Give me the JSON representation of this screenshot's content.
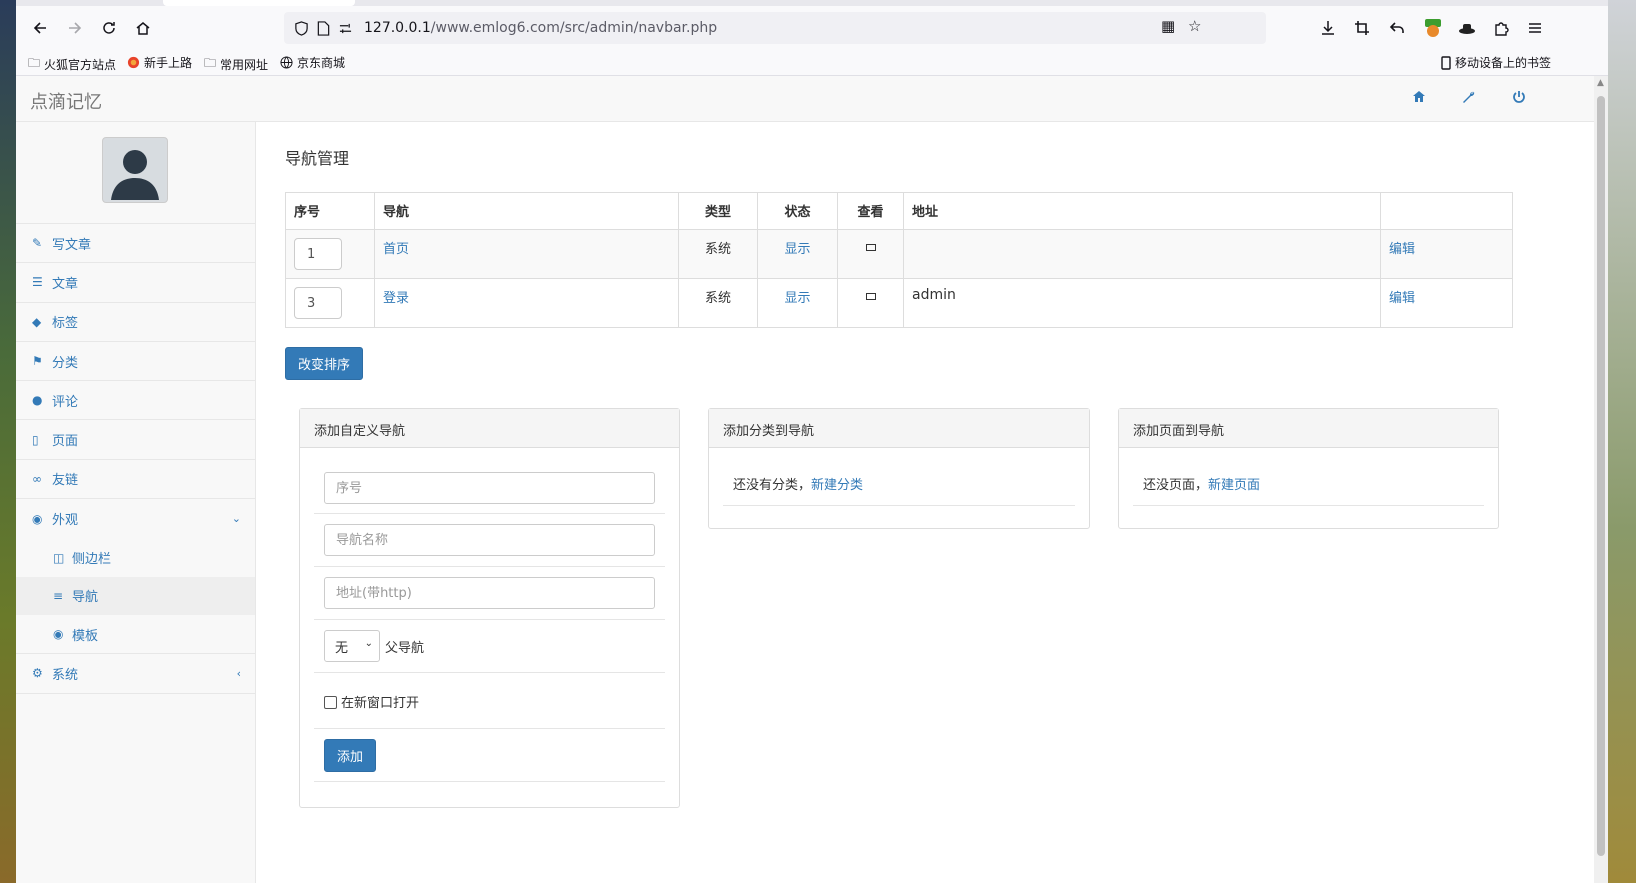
{
  "browser": {
    "url_host": "127.0.0.1",
    "url_path": "/www.emlog6.com/src/admin/navbar.php",
    "bookmarks": [
      "火狐官方站点",
      "新手上路",
      "常用网址",
      "京东商城"
    ],
    "mobile_bookmarks": "移动设备上的书签"
  },
  "header": {
    "brand": "点滴记忆"
  },
  "sidebar": {
    "items": [
      {
        "label": "写文章",
        "icon": "edit-icon"
      },
      {
        "label": "文章",
        "icon": "list-icon"
      },
      {
        "label": "标签",
        "icon": "tags-icon"
      },
      {
        "label": "分类",
        "icon": "flag-icon"
      },
      {
        "label": "评论",
        "icon": "comments-icon"
      },
      {
        "label": "页面",
        "icon": "file-icon"
      },
      {
        "label": "友链",
        "icon": "link-icon"
      },
      {
        "label": "外观",
        "icon": "eye-icon"
      }
    ],
    "sub_items": [
      {
        "label": "侧边栏",
        "icon": "columns-icon"
      },
      {
        "label": "导航",
        "icon": "bars-icon"
      },
      {
        "label": "模板",
        "icon": "eye-icon"
      }
    ],
    "system": {
      "label": "系统",
      "icon": "gear-icon"
    }
  },
  "main": {
    "title": "导航管理",
    "table": {
      "headers": [
        "序号",
        "导航",
        "类型",
        "状态",
        "查看",
        "地址",
        ""
      ],
      "rows": [
        {
          "order": "1",
          "name": "首页",
          "type": "系统",
          "status": "显示",
          "address": "",
          "action": "编辑"
        },
        {
          "order": "3",
          "name": "登录",
          "type": "系统",
          "status": "显示",
          "address": "admin",
          "action": "编辑"
        }
      ]
    },
    "sort_button": "改变排序",
    "custom_panel": {
      "title": "添加自定义导航",
      "order_placeholder": "序号",
      "name_placeholder": "导航名称",
      "url_placeholder": "地址(带http)",
      "parent_select_value": "无",
      "parent_label": "父导航",
      "newtab_label": "在新窗口打开",
      "add_button": "添加"
    },
    "category_panel": {
      "title": "添加分类到导航",
      "empty_text": "还没有分类，",
      "link": "新建分类"
    },
    "page_panel": {
      "title": "添加页面到导航",
      "empty_text": "还没页面，",
      "link": "新建页面"
    }
  }
}
